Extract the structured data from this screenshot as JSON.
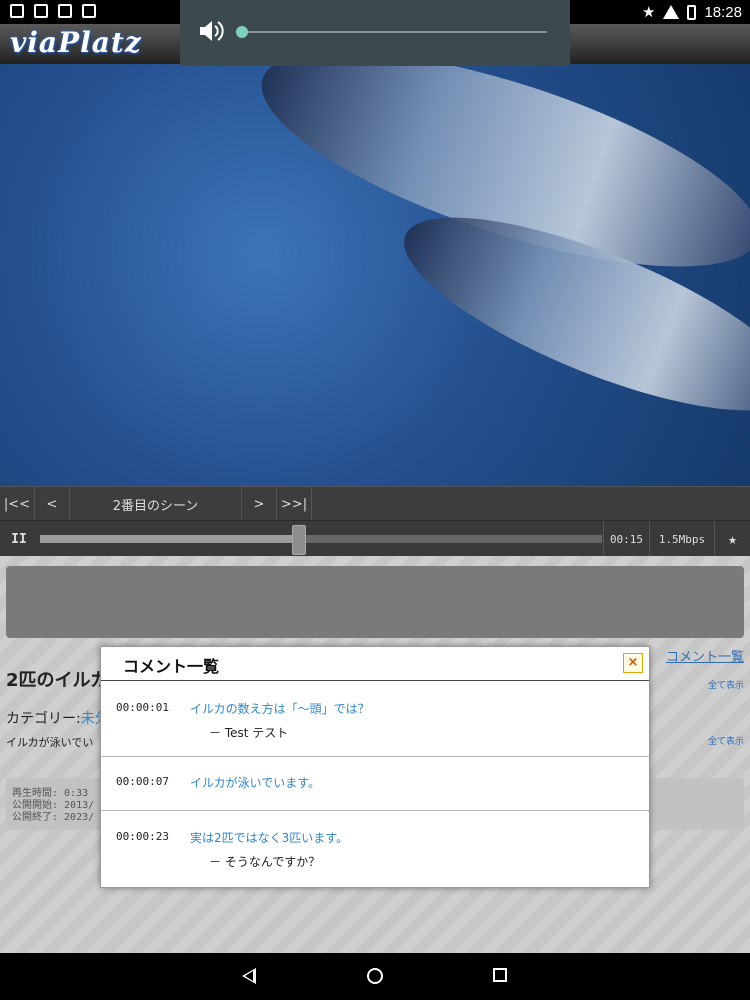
{
  "status_bar": {
    "time": "18:28"
  },
  "app": {
    "logo": "viaPlatz"
  },
  "volume": {
    "level_fraction": 0.0
  },
  "player": {
    "nav": {
      "first": "|<<",
      "prev": "<",
      "scene_title": "2番目のシーン",
      "next": ">",
      "last": ">>|"
    },
    "pause_label": "II",
    "progress_fraction": 0.46,
    "current_time": "00:15",
    "bitrate": "1.5Mbps",
    "star": "★"
  },
  "page": {
    "title": "2匹のイルカ",
    "category_label": "カテゴリー:",
    "category_value": "未分",
    "description": "イルカが泳いでい",
    "meta": {
      "duration": "再生時間: 0:33",
      "start": "公開開始: 2013/",
      "end": "公開終了: 2023/"
    },
    "comment_list_link": "コメント一覧",
    "show_all_1": "全て表示",
    "show_all_2": "全て表示"
  },
  "modal": {
    "title": "コメント一覧",
    "close": "×",
    "comments": [
      {
        "time": "00:00:01",
        "text": "イルカの数え方は「～頭」では？",
        "reply": "－ Test テスト"
      },
      {
        "time": "00:00:07",
        "text": "イルカが泳いでいます。",
        "reply": ""
      },
      {
        "time": "00:00:23",
        "text": "実は2匹ではなく3匹います。",
        "reply": "－ そうなんですか？"
      }
    ]
  }
}
